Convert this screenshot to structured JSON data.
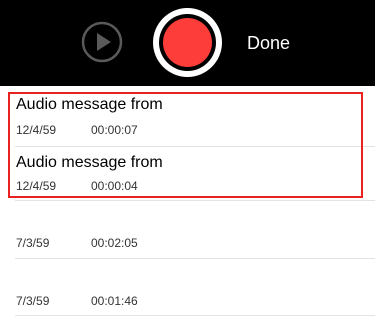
{
  "toolbar": {
    "play_icon": "play-circle-icon",
    "record_icon": "record-icon",
    "done_label": "Done",
    "record_color": "#fc3d39"
  },
  "recordings": [
    {
      "title": "Audio message from",
      "date": "12/4/59",
      "duration": "00:00:07"
    },
    {
      "title": "Audio message from",
      "date": "12/4/59",
      "duration": "00:00:04"
    },
    {
      "title": "",
      "date": "7/3/59",
      "duration": "00:02:05"
    },
    {
      "title": "",
      "date": "7/3/59",
      "duration": "00:01:46"
    }
  ],
  "highlight_color": "#e8231f"
}
